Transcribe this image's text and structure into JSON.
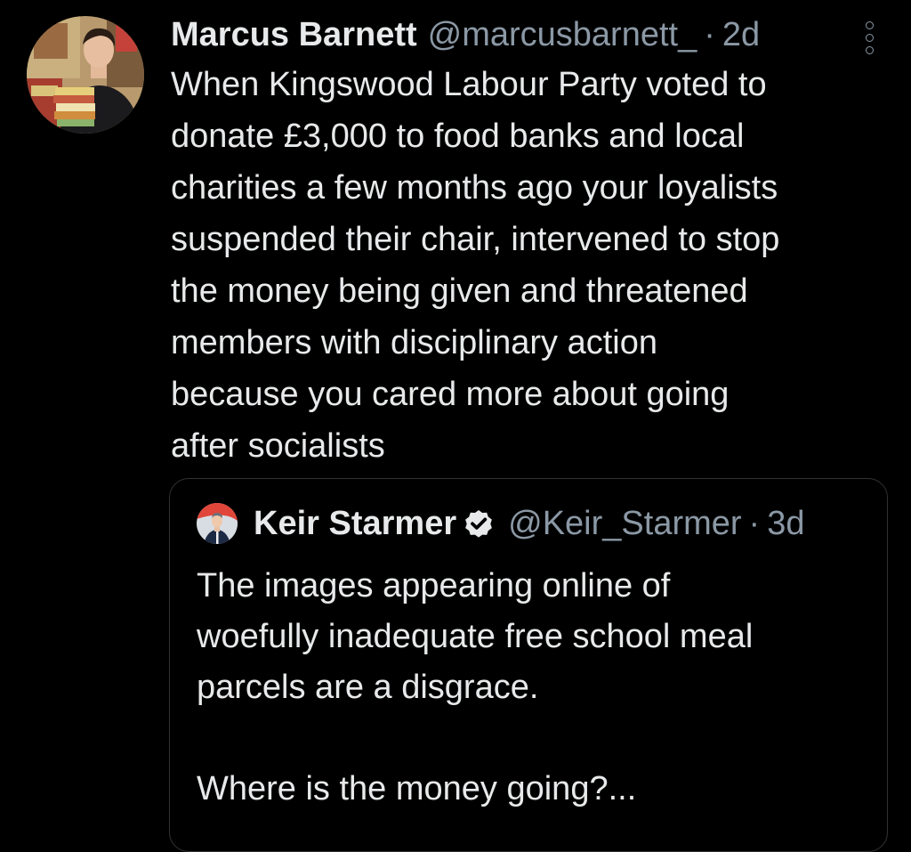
{
  "tweet": {
    "author_name": "Marcus Barnett",
    "author_handle": "@marcusbarnett_",
    "separator": "·",
    "time": "2d",
    "avatar_icon": "user-avatar-photo",
    "more_icon": "more-vertical-icon",
    "text": "When Kingswood Labour Party voted to\ndonate £3,000 to food banks and local\ncharities a few months ago your loyalists\nsuspended their chair, intervened to stop\nthe money being given and threatened\nmembers with disciplinary action\nbecause you cared more about going\nafter socialists"
  },
  "quoted_tweet": {
    "author_name": "Keir Starmer",
    "author_handle": "@Keir_Starmer",
    "separator": "·",
    "time": "3d",
    "verified_icon": "verified-badge-icon",
    "avatar_icon": "user-avatar-photo",
    "text": "The images appearing online of\nwoefully inadequate free school meal\nparcels are a disgrace.\n\nWhere is the money going?..."
  },
  "colors": {
    "background": "#000000",
    "primary_text": "#e7e9ea",
    "secondary_text": "#8b98a5",
    "border": "#2f3336"
  }
}
